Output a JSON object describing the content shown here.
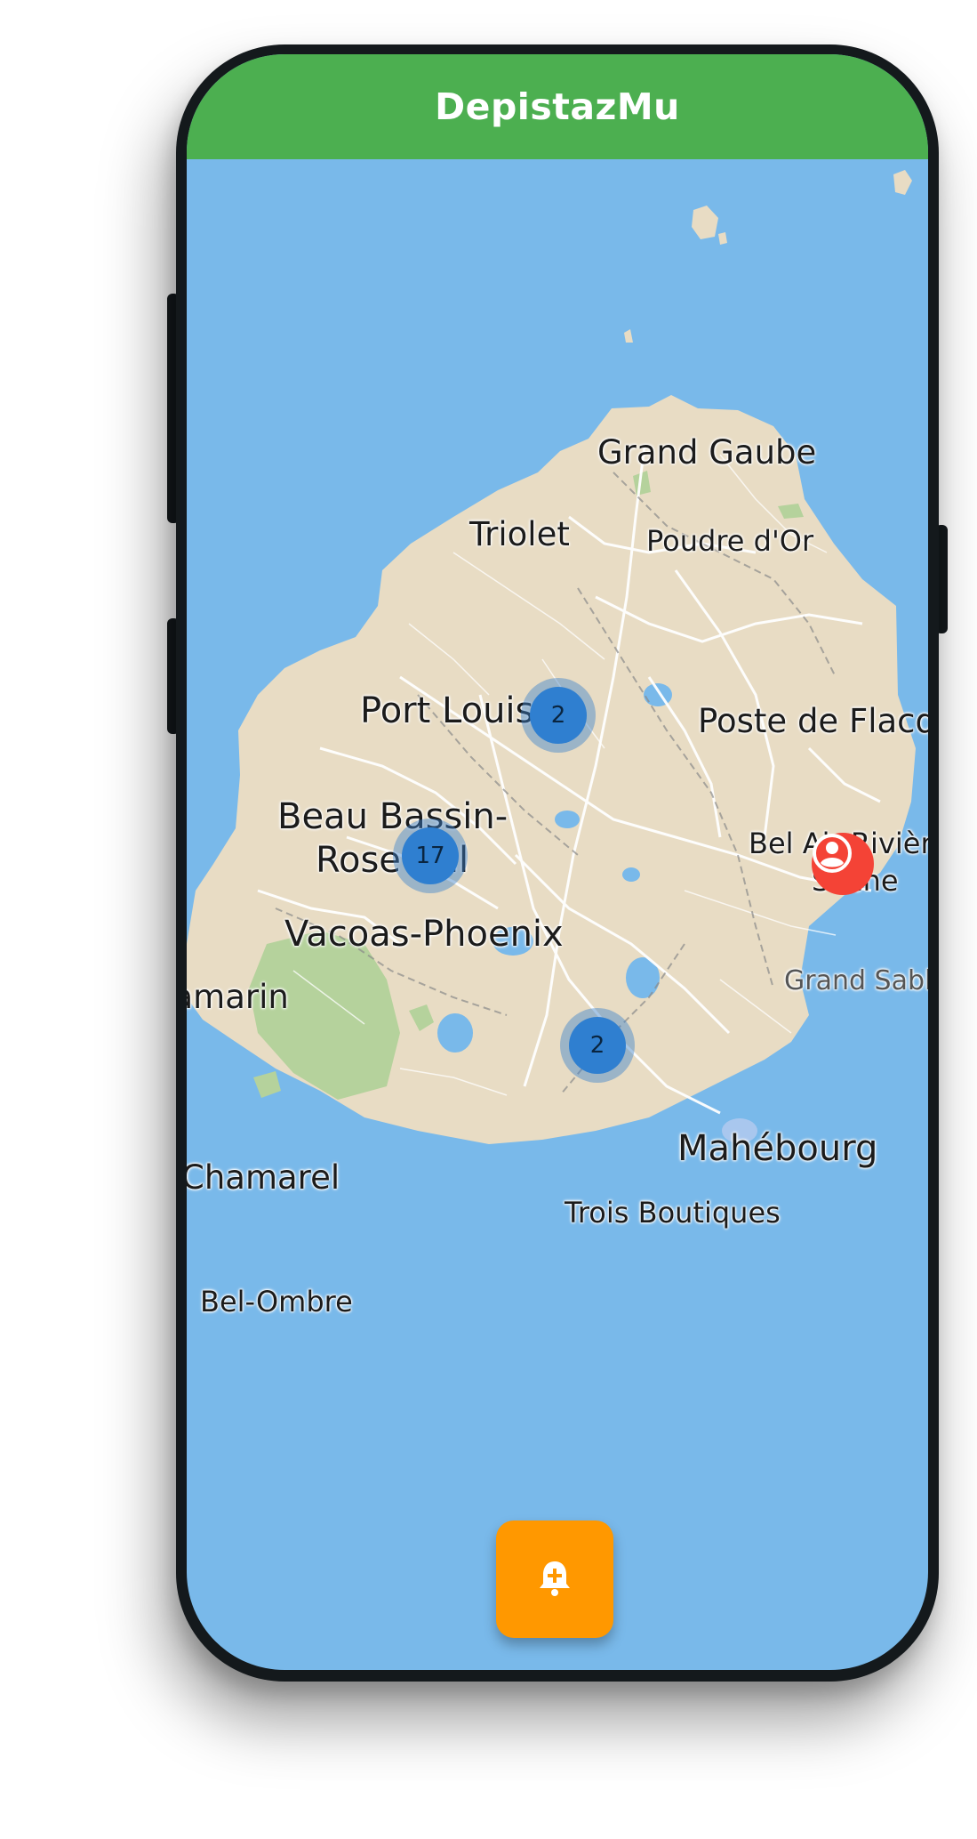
{
  "app_bar": {
    "title": "DepistazMu",
    "color": "#4caf50"
  },
  "map": {
    "water_color": "#79b9ea",
    "land_color": "#e8dcc4",
    "park_color": "#b5d29c",
    "labels": {
      "grand_gaube": "Grand Gaube",
      "triolet": "Triolet",
      "poudre_dor": "Poudre d'Or",
      "port_louis": "Port Louis",
      "poste_de_flacq": "Poste de Flacq",
      "beau_bassin_1": "Beau Bassin-",
      "beau_bassin_2": "Rose Hill",
      "bel_air_1": "Bel Air Rivière",
      "bel_air_2": "Sèche",
      "vacoas": "Vacoas-Phoenix",
      "grand_sable": "Grand Sable",
      "tamarin": "Tamarin",
      "chamarel": "Chamarel",
      "mahebourg": "Mahébourg",
      "trois_boutiques": "Trois Boutiques",
      "bel_ombre": "Bel-Ombre"
    },
    "clusters": [
      {
        "count": "2"
      },
      {
        "count": "17"
      },
      {
        "count": "2"
      }
    ],
    "user_marker": {
      "icon": "account-circle-icon",
      "color": "#f44336"
    }
  },
  "fab": {
    "icon": "bell-plus-icon",
    "color": "#ff9800"
  }
}
